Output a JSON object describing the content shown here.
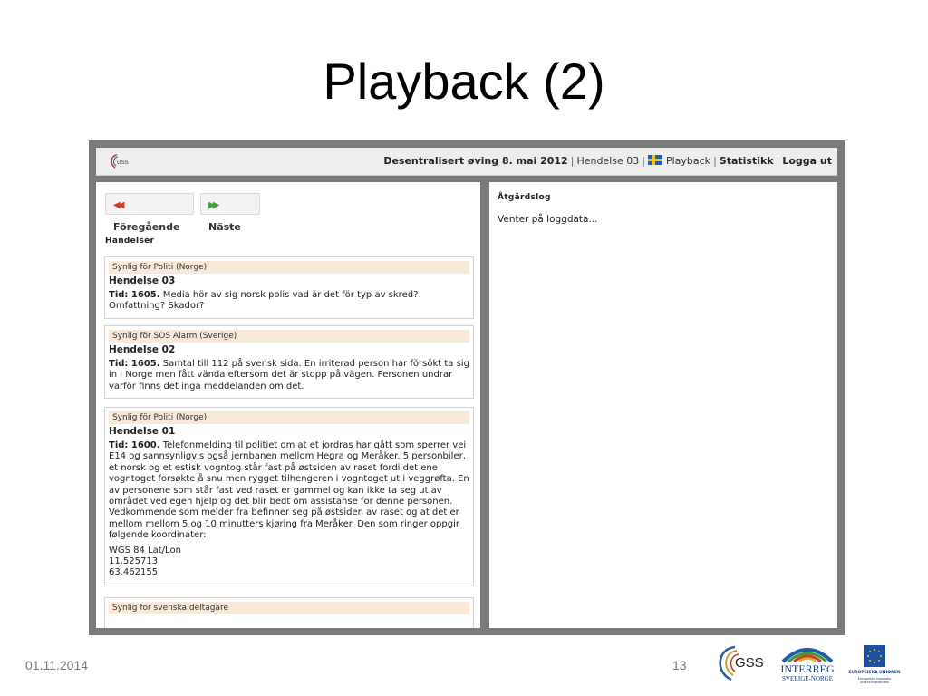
{
  "slide": {
    "title": "Playback (2)",
    "date": "01.11.2014",
    "page_number": "13"
  },
  "header": {
    "logo_text": "GSS",
    "exercise": "Desentralisert øving 8. mai 2012",
    "incident": "Hendelse 03",
    "playback": "Playback",
    "statistics": "Statistikk",
    "logout": "Logga ut",
    "separator": "|"
  },
  "left_panel": {
    "prev_button": "Föregående",
    "next_button": "Näste",
    "heading": "Händelser",
    "events": [
      {
        "visible_for": "Synlig för Politi (Norge)",
        "title": "Hendelse 03",
        "time_label": "Tid: 1605.",
        "text": "Media hör av sig norsk polis vad är det för typ av skred? Omfattning? Skador?"
      },
      {
        "visible_for": "Synlig för SOS Alarm (Sverige)",
        "title": "Hendelse 02",
        "time_label": "Tid: 1605.",
        "text": "Samtal till 112 på svensk sida. En irriterad person har försökt ta sig in i Norge men fått vända eftersom det är stopp på vägen. Personen undrar varför finns det inga meddelanden om det."
      },
      {
        "visible_for": "Synlig för Politi (Norge)",
        "title": "Hendelse 01",
        "time_label": "Tid: 1600.",
        "text": "Telefonmelding til politiet om at et jordras har gått som sperrer vei E14 og sannsynligvis også jernbanen mellom Hegra og Meråker. 5 personbiler, et norsk og et estisk vogntog står fast på østsiden av raset fordi det ene vogntoget forsøkte å snu men rygget tilhengeren i vogntoget ut i veggrøfta. En av personene som står fast ved raset er gammel og kan ikke ta seg ut av området ved egen hjelp og det blir bedt om assistanse for denne personen. Vedkommende som melder fra befinner seg på østsiden av raset og at det er mellom mellom 5 og 10 minutters kjøring fra Meråker. Den som ringer oppgir følgende koordinater:",
        "coord_label": "WGS 84 Lat/Lon",
        "lat": "11.525713",
        "lon": "63.462155"
      },
      {
        "visible_for": "Synlig för svenska deltagare",
        "title": "",
        "time_label": "",
        "text": ""
      }
    ]
  },
  "right_panel": {
    "heading": "Åtgärdslog",
    "status": "Venter på loggdata..."
  },
  "footer": {
    "gss_logo": "GSS",
    "interreg_logo": "INTERREG",
    "interreg_sub": "SVERIGE-NORGE",
    "eu_label": "EUROPEISKA UNIONEN",
    "eu_sub": "Europeiska regionala utvecklingsfonden"
  },
  "colors": {
    "frame": "#7a7a7a",
    "visible_band": "#f8e8d8",
    "prev_arrow": "#d23a2a",
    "next_arrow": "#3aa43a",
    "eu_blue": "#1f4fa0"
  },
  "icons": [
    "gss-logo-icon",
    "sweden-flag-icon",
    "double-left-arrow-icon",
    "double-right-arrow-icon",
    "interreg-arc-icon",
    "eu-stars-icon"
  ]
}
